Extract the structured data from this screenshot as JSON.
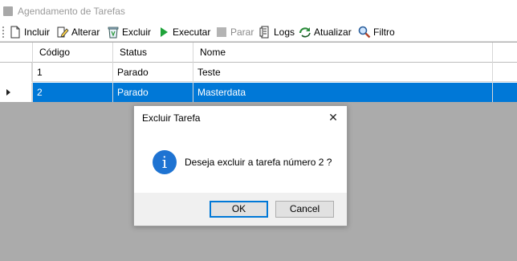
{
  "window": {
    "title": "Agendamento de Tarefas",
    "icon": "app-window-icon"
  },
  "toolbar": {
    "items": [
      {
        "label": "Incluir",
        "icon": "document-new-icon",
        "enabled": true
      },
      {
        "label": "Alterar",
        "icon": "edit-pencil-icon",
        "enabled": true
      },
      {
        "label": "Excluir",
        "icon": "recycle-bin-icon",
        "enabled": true
      },
      {
        "label": "Executar",
        "icon": "play-icon",
        "enabled": true
      },
      {
        "label": "Parar",
        "icon": "stop-icon",
        "enabled": false
      },
      {
        "label": "Logs",
        "icon": "log-file-icon",
        "enabled": true
      },
      {
        "label": "Atualizar",
        "icon": "refresh-icon",
        "enabled": true
      },
      {
        "label": "Filtro",
        "icon": "magnifier-icon",
        "enabled": true
      }
    ]
  },
  "grid": {
    "columns": [
      "Código",
      "Status",
      "Nome"
    ],
    "rows": [
      {
        "codigo": "1",
        "status": "Parado",
        "nome": "Teste",
        "selected": false
      },
      {
        "codigo": "2",
        "status": "Parado",
        "nome": "Masterdata",
        "selected": true
      }
    ]
  },
  "dialog": {
    "title": "Excluir Tarefa",
    "close_glyph": "✕",
    "icon": "information-icon",
    "icon_glyph": "i",
    "message": "Deseja excluir a tarefa número 2 ?",
    "ok_label": "OK",
    "cancel_label": "Cancel"
  },
  "colors": {
    "selection": "#0078d7",
    "backdrop": "#ababab",
    "info": "#1e73d2"
  }
}
